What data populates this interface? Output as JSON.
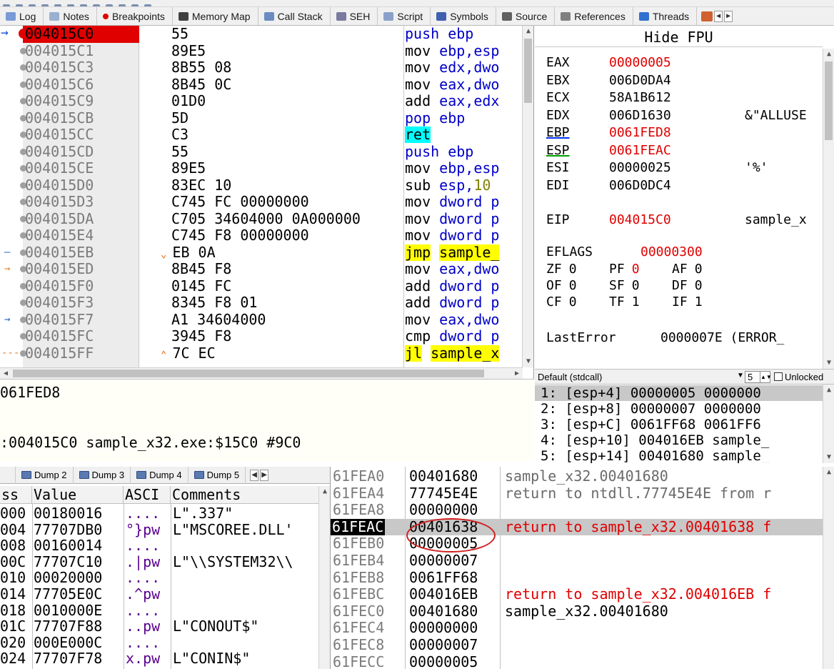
{
  "tabs": [
    {
      "label": "Log",
      "icon": "log-icon",
      "color": "#7a9ad8"
    },
    {
      "label": "Notes",
      "icon": "notes-icon",
      "color": "#9ab0d0"
    },
    {
      "label": "Breakpoints",
      "icon": "breakpoint-dot-icon",
      "color": "#e00000"
    },
    {
      "label": "Memory Map",
      "icon": "memory-map-icon",
      "color": "#404040"
    },
    {
      "label": "Call Stack",
      "icon": "call-stack-icon",
      "color": "#6a8cc0"
    },
    {
      "label": "SEH",
      "icon": "seh-icon",
      "color": "#7a7aa0"
    },
    {
      "label": "Script",
      "icon": "script-icon",
      "color": "#8aa0c8"
    },
    {
      "label": "Symbols",
      "icon": "symbols-icon",
      "color": "#4060b0"
    },
    {
      "label": "Source",
      "icon": "source-icon",
      "color": "#606060"
    },
    {
      "label": "References",
      "icon": "search-icon",
      "color": "#808080"
    },
    {
      "label": "Threads",
      "icon": "threads-icon",
      "color": "#3070d0"
    }
  ],
  "disasm": {
    "rows": [
      {
        "addr": "004015C0",
        "bytes": "55",
        "inst": [
          [
            "push ebp",
            "kw-blue"
          ]
        ],
        "current": true
      },
      {
        "addr": "004015C1",
        "bytes": "89E5",
        "inst": [
          [
            "mov ",
            "kw-black"
          ],
          [
            "ebp,esp",
            "kw-blue"
          ]
        ]
      },
      {
        "addr": "004015C3",
        "bytes": "8B55 08",
        "inst": [
          [
            "mov ",
            "kw-black"
          ],
          [
            "edx,dwo",
            "kw-blue"
          ]
        ]
      },
      {
        "addr": "004015C6",
        "bytes": "8B45 0C",
        "inst": [
          [
            "mov ",
            "kw-black"
          ],
          [
            "eax,dwo",
            "kw-blue"
          ]
        ]
      },
      {
        "addr": "004015C9",
        "bytes": "01D0",
        "inst": [
          [
            "add ",
            "kw-black"
          ],
          [
            "eax,edx",
            "kw-blue"
          ]
        ]
      },
      {
        "addr": "004015CB",
        "bytes": "5D",
        "inst": [
          [
            "pop ebp",
            "kw-blue"
          ]
        ]
      },
      {
        "addr": "004015CC",
        "bytes": "C3",
        "inst": [
          [
            "ret",
            "hl-cyan"
          ]
        ]
      },
      {
        "addr": "004015CD",
        "bytes": "55",
        "inst": [
          [
            "push ebp",
            "kw-blue"
          ]
        ]
      },
      {
        "addr": "004015CE",
        "bytes": "89E5",
        "inst": [
          [
            "mov ",
            "kw-black"
          ],
          [
            "ebp,esp",
            "kw-blue"
          ]
        ]
      },
      {
        "addr": "004015D0",
        "bytes": "83EC 10",
        "inst": [
          [
            "sub ",
            "kw-black"
          ],
          [
            "esp,",
            "kw-blue"
          ],
          [
            "10",
            "num-olive"
          ]
        ]
      },
      {
        "addr": "004015D3",
        "bytes": "C745 FC 00000000",
        "inst": [
          [
            "mov ",
            "kw-black"
          ],
          [
            "dword p",
            "kw-blue"
          ]
        ]
      },
      {
        "addr": "004015DA",
        "bytes": "C705 34604000 0A000000",
        "inst": [
          [
            "mov ",
            "kw-black"
          ],
          [
            "dword p",
            "kw-blue"
          ]
        ]
      },
      {
        "addr": "004015E4",
        "bytes": "C745 F8 00000000",
        "inst": [
          [
            "mov ",
            "kw-black"
          ],
          [
            "dword p",
            "kw-blue"
          ]
        ]
      },
      {
        "addr": "004015EB",
        "bytes": "EB 0A",
        "inst": [
          [
            "jmp",
            "hl-yellow"
          ],
          [
            " ",
            "kw-black"
          ],
          [
            "sample_",
            "hl-yellow"
          ]
        ],
        "jump": "down"
      },
      {
        "addr": "004015ED",
        "bytes": "8B45 F8",
        "inst": [
          [
            "mov ",
            "kw-black"
          ],
          [
            "eax,dwo",
            "kw-blue"
          ]
        ]
      },
      {
        "addr": "004015F0",
        "bytes": "0145 FC",
        "inst": [
          [
            "add ",
            "kw-black"
          ],
          [
            "dword p",
            "kw-blue"
          ]
        ]
      },
      {
        "addr": "004015F3",
        "bytes": "8345 F8 01",
        "inst": [
          [
            "add ",
            "kw-black"
          ],
          [
            "dword p",
            "kw-blue"
          ]
        ]
      },
      {
        "addr": "004015F7",
        "bytes": "A1 34604000",
        "inst": [
          [
            "mov ",
            "kw-black"
          ],
          [
            "eax,dwo",
            "kw-blue"
          ]
        ]
      },
      {
        "addr": "004015FC",
        "bytes": "3945 F8",
        "inst": [
          [
            "cmp ",
            "kw-black"
          ],
          [
            "dword p",
            "kw-blue"
          ]
        ]
      },
      {
        "addr": "004015FF",
        "bytes": "7C EC",
        "inst": [
          [
            "jl",
            "hl-yellow"
          ],
          [
            " ",
            "kw-black"
          ],
          [
            "sample_x",
            "hl-yellow"
          ]
        ],
        "jump": "up"
      }
    ]
  },
  "info": {
    "line1": "061FED8",
    "line2": ":004015C0 sample_x32.exe:$15C0 #9C0"
  },
  "registers": {
    "hide_fpu": "Hide FPU",
    "gp": [
      {
        "name": "EAX",
        "value": "00000005",
        "changed": true,
        "comment": ""
      },
      {
        "name": "EBX",
        "value": "006D0DA4",
        "changed": false,
        "comment": ""
      },
      {
        "name": "ECX",
        "value": "58A1B612",
        "changed": false,
        "comment": ""
      },
      {
        "name": "EDX",
        "value": "006D1630",
        "changed": false,
        "comment": "&\"ALLUSE"
      },
      {
        "name": "EBP",
        "value": "0061FED8",
        "changed": true,
        "comment": ""
      },
      {
        "name": "ESP",
        "value": "0061FEAC",
        "changed": true,
        "comment": ""
      },
      {
        "name": "ESI",
        "value": "00000025",
        "changed": false,
        "comment": "'%'"
      },
      {
        "name": "EDI",
        "value": "006D0DC4",
        "changed": false,
        "comment": ""
      }
    ],
    "eip": {
      "name": "EIP",
      "value": "004015C0",
      "comment": "sample_x"
    },
    "eflags": {
      "name": "EFLAGS",
      "value": "00000300"
    },
    "flags_rows": [
      [
        {
          "n": "ZF",
          "v": "0"
        },
        {
          "n": "PF",
          "v": "0",
          "changed": true
        },
        {
          "n": "AF",
          "v": "0"
        }
      ],
      [
        {
          "n": "OF",
          "v": "0"
        },
        {
          "n": "SF",
          "v": "0"
        },
        {
          "n": "DF",
          "v": "0"
        }
      ],
      [
        {
          "n": "CF",
          "v": "0"
        },
        {
          "n": "TF",
          "v": "1"
        },
        {
          "n": "IF",
          "v": "1"
        }
      ]
    ],
    "lasterror": {
      "name": "LastError",
      "value": "0000007E (ERROR_"
    }
  },
  "callconv": {
    "convention": "Default (stdcall)",
    "count": "5",
    "unlocked_label": "Unlocked"
  },
  "args": [
    "1: [esp+4] 00000005 0000000",
    "2: [esp+8] 00000007 0000000",
    "3: [esp+C] 0061FF68 0061FF6",
    "4: [esp+10] 004016EB sample_",
    "5: [esp+14] 00401680 sample_"
  ],
  "dump_tabs": [
    "Dump 2",
    "Dump 3",
    "Dump 4",
    "Dump 5"
  ],
  "dump": {
    "headers": {
      "address": "ss",
      "value": "Value",
      "ascii": "ASCI",
      "comments": "Comments"
    },
    "rows": [
      {
        "a": "000",
        "v": "00180016",
        "s": "....",
        "c": "L\".337\""
      },
      {
        "a": "004",
        "v": "77707DB0",
        "s": "°}pw",
        "c": "L\"MSCOREE.DLL'"
      },
      {
        "a": "008",
        "v": "00160014",
        "s": "....",
        "c": ""
      },
      {
        "a": "00C",
        "v": "77707C10",
        "s": ".|pw",
        "c": "L\"\\\\SYSTEM32\\\\"
      },
      {
        "a": "010",
        "v": "00020000",
        "s": "....",
        "c": ""
      },
      {
        "a": "014",
        "v": "77705E0C",
        "s": ".^pw",
        "c": ""
      },
      {
        "a": "018",
        "v": "0010000E",
        "s": "....",
        "c": ""
      },
      {
        "a": "01C",
        "v": "77707F88",
        "s": "..pw",
        "c": "L\"CONOUT$\""
      },
      {
        "a": "020",
        "v": "000E000C",
        "s": "....",
        "c": ""
      },
      {
        "a": "024",
        "v": "77707F78",
        "s": "x.pw",
        "c": "L\"CONIN$\""
      }
    ]
  },
  "stack": {
    "rows": [
      {
        "a": "61FEA0",
        "v": "00401680",
        "c": "sample_x32.00401680",
        "red": false
      },
      {
        "a": "61FEA4",
        "v": "77745E4E",
        "c": "return to ntdll.77745E4E from r",
        "red": false
      },
      {
        "a": "61FEA8",
        "v": "00000000",
        "c": "",
        "red": false
      },
      {
        "a": "61FEAC",
        "v": "00401638",
        "c": "return to sample_x32.00401638 f",
        "red": true,
        "current": true
      },
      {
        "a": "61FEB0",
        "v": "00000005",
        "c": "",
        "red": false
      },
      {
        "a": "61FEB4",
        "v": "00000007",
        "c": "",
        "red": false
      },
      {
        "a": "61FEB8",
        "v": "0061FF68",
        "c": "",
        "red": false
      },
      {
        "a": "61FEBC",
        "v": "004016EB",
        "c": "return to sample_x32.004016EB f",
        "red": true
      },
      {
        "a": "61FEC0",
        "v": "00401680",
        "c": "sample_x32.00401680",
        "red": false,
        "dark": true
      },
      {
        "a": "61FEC4",
        "v": "00000000",
        "c": "",
        "red": false
      },
      {
        "a": "61FEC8",
        "v": "00000007",
        "c": "",
        "red": false
      },
      {
        "a": "61FECC",
        "v": "00000005",
        "c": "",
        "red": false
      }
    ]
  }
}
